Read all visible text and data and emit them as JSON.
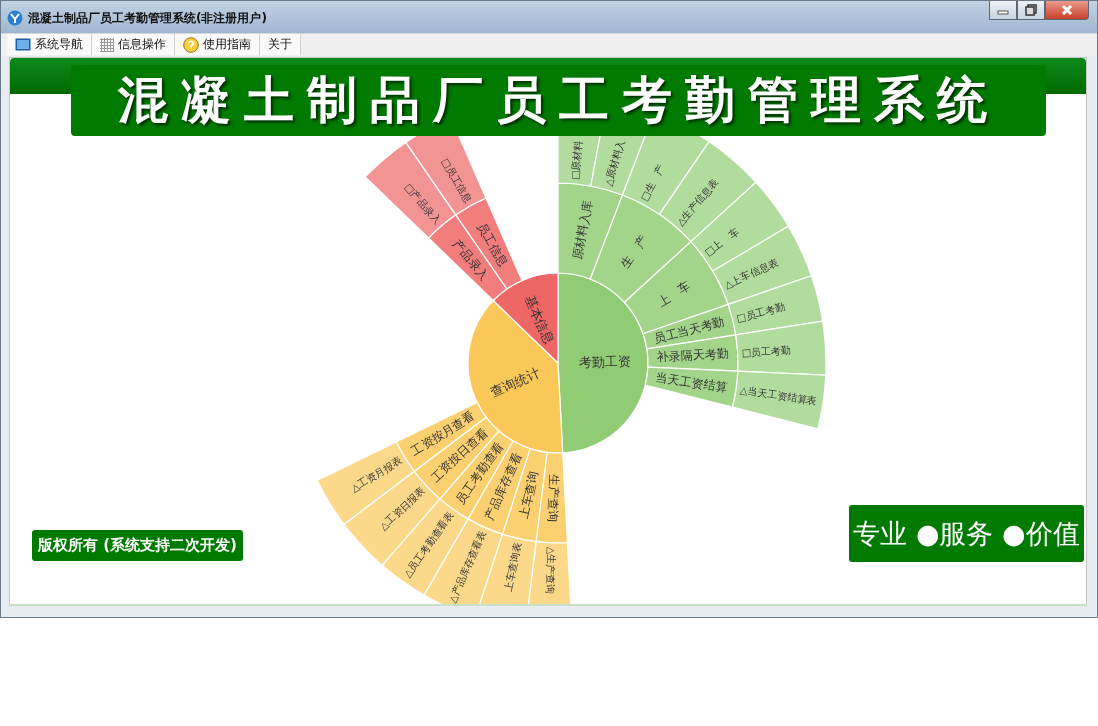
{
  "window": {
    "title": "混凝土制品厂员工考勤管理系统(非注册用户)"
  },
  "menu": [
    {
      "label": "系统导航"
    },
    {
      "label": "信息操作"
    },
    {
      "label": "使用指南"
    },
    {
      "label": "关于"
    }
  ],
  "banner": {
    "title": "混凝土制品厂员工考勤管理系统"
  },
  "sunburst": {
    "nodes": [
      {
        "label": "考勤工资",
        "color": "#91cc75",
        "children": [
          {
            "label": "原材料入库",
            "children": [
              {
                "label": "□原材料"
              },
              {
                "label": "△原材料入"
              }
            ]
          },
          {
            "label": "生　产",
            "children": [
              {
                "label": "□生　产"
              },
              {
                "label": "△生产信息表"
              }
            ]
          },
          {
            "label": "上　车",
            "children": [
              {
                "label": "□上　车"
              },
              {
                "label": "△上车信息表"
              }
            ]
          },
          {
            "label": "员工当天考勤",
            "children": [
              {
                "label": "□员工考勤"
              }
            ]
          },
          {
            "label": "补录隔天考勤",
            "children": [
              {
                "label": "□员工考勤"
              }
            ]
          },
          {
            "label": "当天工资结算",
            "children": [
              {
                "label": "△当天工资结算表"
              }
            ]
          }
        ]
      },
      {
        "label": "查询统计",
        "color": "#fac858",
        "children": [
          {
            "label": "生产查询",
            "children": [
              {
                "label": "△生产查询"
              }
            ]
          },
          {
            "label": "上车查询",
            "children": [
              {
                "label": "上车查询表"
              }
            ]
          },
          {
            "label": "产品库存查看",
            "children": [
              {
                "label": "△产品库存查看表"
              }
            ]
          },
          {
            "label": "员工考勤查看",
            "children": [
              {
                "label": "△员工考勤查看表"
              }
            ]
          },
          {
            "label": "工资按日查看",
            "children": [
              {
                "label": "△工资日报表"
              }
            ]
          },
          {
            "label": "工资按月查看",
            "children": [
              {
                "label": "△工资月报表"
              }
            ]
          }
        ]
      },
      {
        "label": "基本信息",
        "color": "#ee6666",
        "children": [
          {
            "label": "产品录入",
            "children": [
              {
                "label": "□产品录入"
              }
            ]
          },
          {
            "label": "员工信息",
            "children": [
              {
                "label": "□员工信息"
              }
            ]
          }
        ]
      }
    ]
  },
  "copyright": "版权所有 (系统支持二次开发)",
  "slogan": "专业 ●服务 ●价值"
}
